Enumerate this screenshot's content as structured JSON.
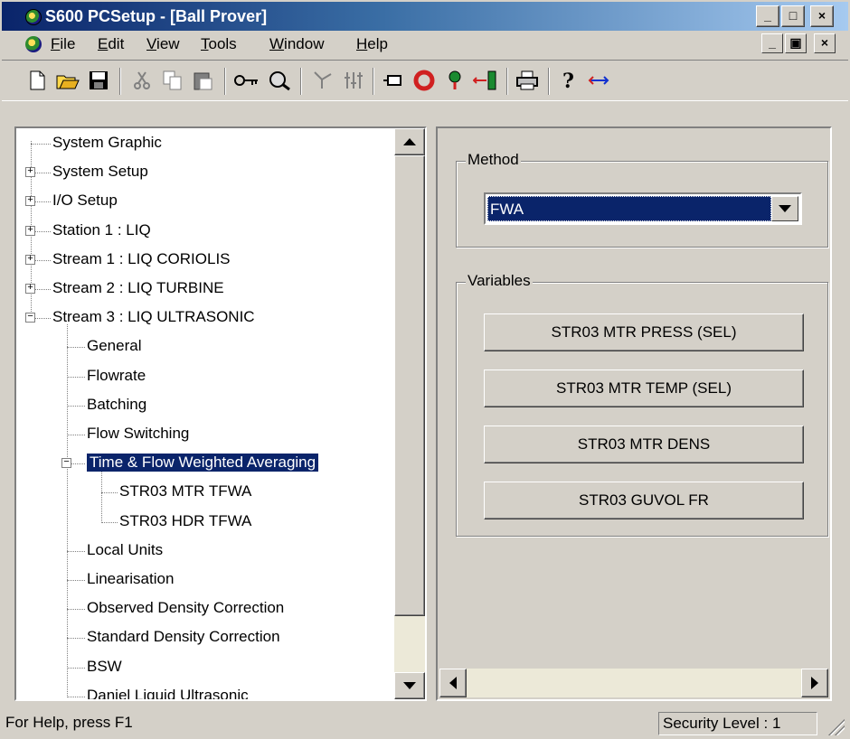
{
  "window": {
    "title": "S600 PCSetup - [Ball Prover]"
  },
  "caption_buttons": {
    "minimize": "_",
    "maximize": "□",
    "close": "×"
  },
  "mdi_buttons": {
    "minimize": "_",
    "restore": "▣",
    "close": "×"
  },
  "menu": {
    "items": [
      {
        "label": "File",
        "accel": "F",
        "rest": "ile"
      },
      {
        "label": "Edit",
        "accel": "E",
        "rest": "dit"
      },
      {
        "label": "View",
        "accel": "V",
        "rest": "iew"
      },
      {
        "label": "Tools",
        "accel": "T",
        "rest": "ools"
      },
      {
        "label": "Window",
        "accel": "W",
        "rest": "indow"
      },
      {
        "label": "Help",
        "accel": "H",
        "rest": "elp"
      }
    ]
  },
  "toolbar": {
    "buttons": [
      "new-icon",
      "open-icon",
      "save-icon",
      "cut-icon",
      "copy-icon",
      "paste-icon",
      "key-icon",
      "connect-icon",
      "tree-icon",
      "tune-icon",
      "port-icon",
      "stop-icon",
      "probe-icon",
      "transfer-icon",
      "print-icon",
      "help-icon",
      "swap-icon"
    ]
  },
  "tree": {
    "nodes": [
      {
        "label": "System Graphic",
        "level": 0,
        "expander": ""
      },
      {
        "label": "System Setup",
        "level": 0,
        "expander": "+"
      },
      {
        "label": "I/O Setup",
        "level": 0,
        "expander": "+"
      },
      {
        "label": "Station 1 : LIQ",
        "level": 0,
        "expander": "+"
      },
      {
        "label": "Stream 1 : LIQ CORIOLIS",
        "level": 0,
        "expander": "+"
      },
      {
        "label": "Stream 2 : LIQ TURBINE",
        "level": 0,
        "expander": "+"
      },
      {
        "label": "Stream 3 : LIQ ULTRASONIC",
        "level": 0,
        "expander": "-"
      },
      {
        "label": "General",
        "level": 1,
        "expander": ""
      },
      {
        "label": "Flowrate",
        "level": 1,
        "expander": ""
      },
      {
        "label": "Batching",
        "level": 1,
        "expander": ""
      },
      {
        "label": "Flow Switching",
        "level": 1,
        "expander": ""
      },
      {
        "label": "Time & Flow Weighted Averaging",
        "level": 1,
        "expander": "-",
        "selected": true
      },
      {
        "label": "STR03 MTR TFWA",
        "level": 2,
        "expander": ""
      },
      {
        "label": "STR03 HDR TFWA",
        "level": 2,
        "expander": ""
      },
      {
        "label": "Local Units",
        "level": 1,
        "expander": ""
      },
      {
        "label": "Linearisation",
        "level": 1,
        "expander": ""
      },
      {
        "label": "Observed Density Correction",
        "level": 1,
        "expander": ""
      },
      {
        "label": "Standard Density Correction",
        "level": 1,
        "expander": ""
      },
      {
        "label": "BSW",
        "level": 1,
        "expander": ""
      },
      {
        "label": "Daniel Liquid Ultrasonic",
        "level": 1,
        "expander": ""
      }
    ]
  },
  "method": {
    "group_label": "Method",
    "selected": "FWA"
  },
  "variables": {
    "group_label": "Variables",
    "buttons": [
      "STR03 MTR PRESS (SEL)",
      "STR03 MTR TEMP (SEL)",
      "STR03 MTR DENS",
      "STR03 GUVOL FR"
    ]
  },
  "status": {
    "help": "For Help, press F1",
    "security": "Security Level : 1"
  },
  "colors": {
    "selection": "#0a246a",
    "face": "#d4d0c8",
    "title_start": "#0a246a",
    "title_end": "#a6caf0"
  }
}
